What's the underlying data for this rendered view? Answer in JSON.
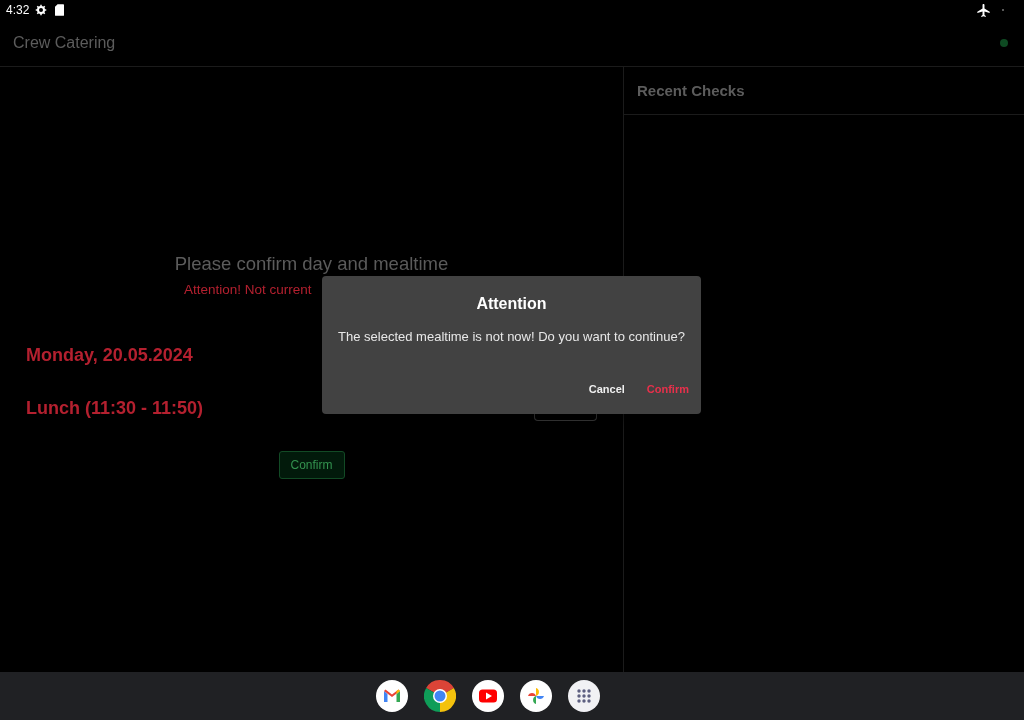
{
  "status_bar": {
    "time": "4:32"
  },
  "app_bar": {
    "title": "Crew Catering"
  },
  "meal_panel": {
    "heading": "Please confirm day and mealtime",
    "warning": "Attention! Not current",
    "day": "Monday, 20.05.2024",
    "mealtime": "Lunch (11:30 - 11:50)",
    "confirm_button": "Confirm"
  },
  "recent_checks": {
    "title": "Recent Checks"
  },
  "dialog": {
    "title": "Attention",
    "message": "The selected mealtime is not now! Do you want to continue?",
    "buttons": [
      {
        "label": "Cancel",
        "kind": "neutral"
      },
      {
        "label": "Confirm",
        "kind": "primary"
      }
    ]
  }
}
